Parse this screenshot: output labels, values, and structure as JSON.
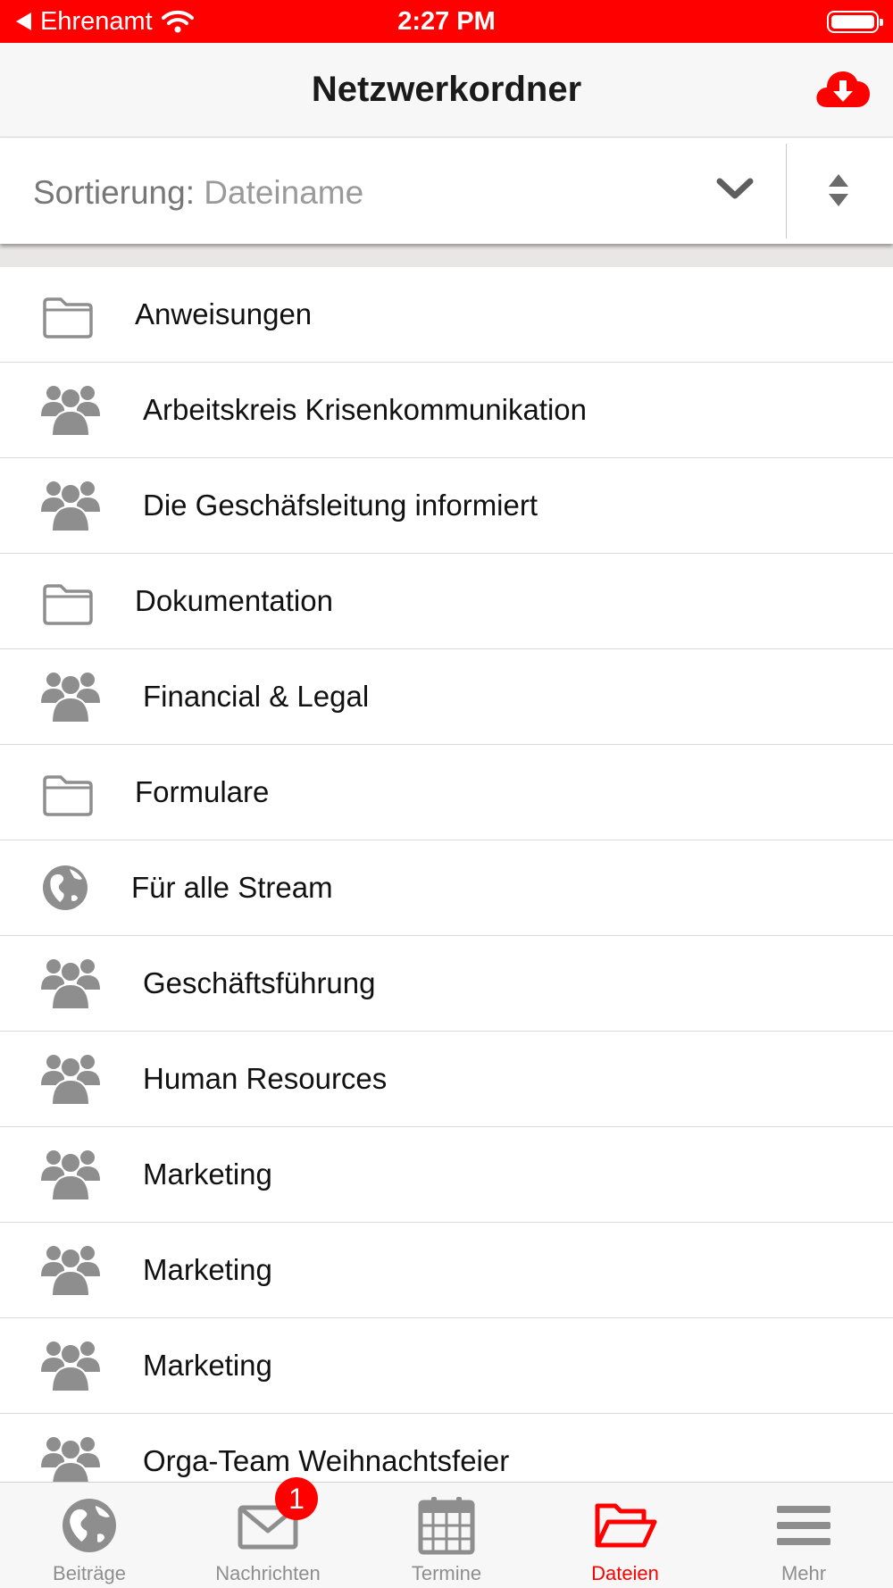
{
  "status_bar": {
    "back_label": "Ehrenamt",
    "time": "2:27 PM"
  },
  "nav": {
    "title": "Netzwerkordner",
    "download_icon": "cloud-download-icon"
  },
  "sort": {
    "label": "Sortierung:",
    "value": "Dateiname",
    "dropdown_icon": "chevron-down-icon",
    "order_icon": "sort-order-icon"
  },
  "colors": {
    "accent": "#ff0000",
    "icon_gray": "#8e8e8e"
  },
  "list": {
    "items": [
      {
        "label": "Anweisungen",
        "icon": "folder-icon"
      },
      {
        "label": "Arbeitskreis Krisenkommunikation",
        "icon": "group-icon"
      },
      {
        "label": "Die Geschäfsleitung informiert",
        "icon": "group-icon"
      },
      {
        "label": "Dokumentation",
        "icon": "folder-icon"
      },
      {
        "label": "Financial & Legal",
        "icon": "group-icon"
      },
      {
        "label": "Formulare",
        "icon": "folder-icon"
      },
      {
        "label": "Für alle Stream",
        "icon": "globe-icon"
      },
      {
        "label": "Geschäftsführung",
        "icon": "group-icon"
      },
      {
        "label": "Human Resources",
        "icon": "group-icon"
      },
      {
        "label": "Marketing",
        "icon": "group-icon"
      },
      {
        "label": "Marketing",
        "icon": "group-icon"
      },
      {
        "label": "Marketing",
        "icon": "group-icon"
      },
      {
        "label": "Orga-Team Weihnachtsfeier",
        "icon": "group-icon"
      }
    ]
  },
  "tabs": {
    "items": [
      {
        "label": "Beiträge",
        "icon": "globe-icon",
        "active": false
      },
      {
        "label": "Nachrichten",
        "icon": "envelope-icon",
        "active": false
      },
      {
        "label": "Termine",
        "icon": "calendar-icon",
        "active": false
      },
      {
        "label": "Dateien",
        "icon": "folder-open-icon",
        "active": true
      },
      {
        "label": "Mehr",
        "icon": "menu-icon",
        "active": false
      }
    ],
    "badge": "1"
  }
}
